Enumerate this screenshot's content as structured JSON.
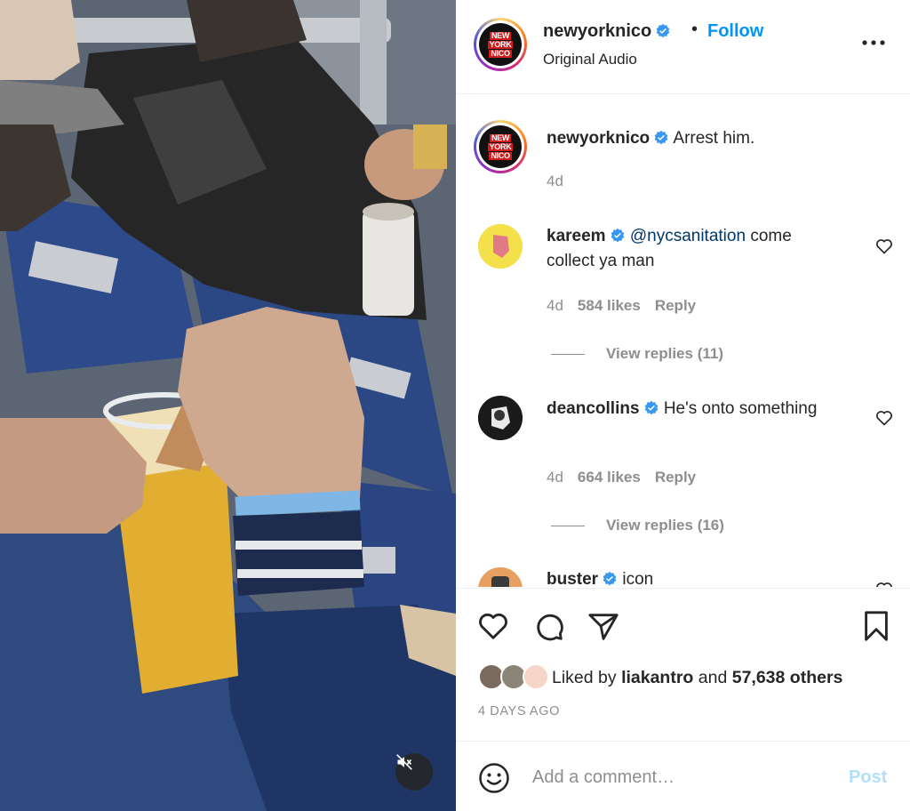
{
  "post": {
    "author": "newyorknico",
    "author_logo_text": [
      "NEW",
      "YORK",
      "NICO"
    ],
    "follow_label": "Follow",
    "separator": "•",
    "audio": "Original Audio"
  },
  "caption": {
    "author": "newyorknico",
    "text": "Arrest him.",
    "time": "4d"
  },
  "comments": [
    {
      "author": "kareem",
      "mention": "@nycsanitation",
      "text": " come collect ya man",
      "time": "4d",
      "likes": "584 likes",
      "reply_label": "Reply",
      "view_replies": "View replies (11)"
    },
    {
      "author": "deancollins",
      "mention": "",
      "text": "He's onto something",
      "time": "4d",
      "likes": "664 likes",
      "reply_label": "Reply",
      "view_replies": "View replies (16)"
    },
    {
      "author": "buster",
      "mention": "",
      "text": "icon",
      "time": "",
      "likes": "",
      "reply_label": "",
      "view_replies": ""
    }
  ],
  "likes": {
    "prefix": "Liked by",
    "user": "liakantro",
    "middle": "and",
    "others": "57,638 others"
  },
  "date": "4 DAYS AGO",
  "add_comment": {
    "placeholder": "Add a comment…",
    "post_label": "Post"
  },
  "icons": {
    "verified": "verified-badge-icon",
    "more": "more-options-icon",
    "like": "heart-icon",
    "comment": "comment-bubble-icon",
    "share": "paper-plane-icon",
    "save": "bookmark-icon",
    "emoji": "smiley-icon",
    "mute": "speaker-muted-icon"
  },
  "colors": {
    "accent": "#0095f6",
    "verified": "#3897f0",
    "mention": "#00376b",
    "post_disabled": "#b2dffc",
    "muted_text": "#8e8e8e"
  }
}
